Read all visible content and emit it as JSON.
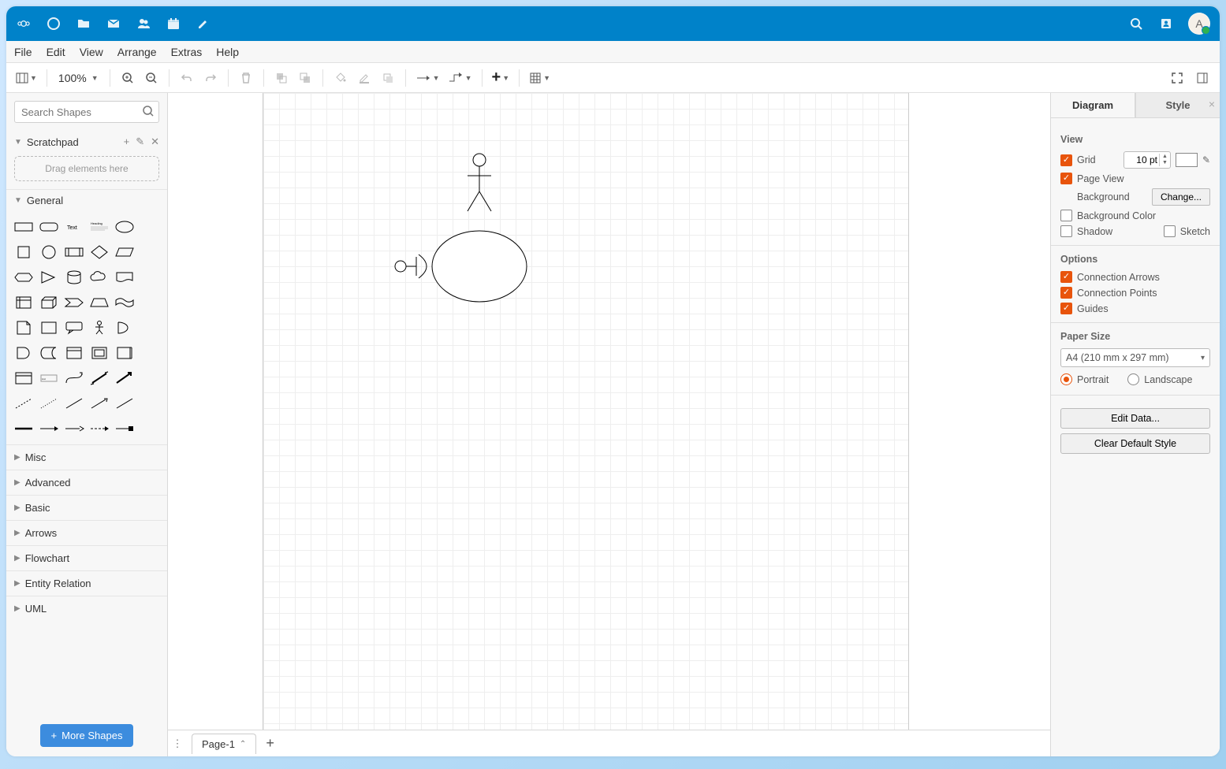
{
  "titlebar": {
    "avatar_initial": "A"
  },
  "menubar": {
    "file": "File",
    "edit": "Edit",
    "view": "View",
    "arrange": "Arrange",
    "extras": "Extras",
    "help": "Help"
  },
  "toolbar": {
    "zoom": "100%"
  },
  "left": {
    "search_placeholder": "Search Shapes",
    "scratchpad": "Scratchpad",
    "scratch_drop": "Drag elements here",
    "general": "General",
    "cats": [
      "Misc",
      "Advanced",
      "Basic",
      "Arrows",
      "Flowchart",
      "Entity Relation",
      "UML"
    ],
    "more": "More Shapes"
  },
  "right": {
    "tab_diagram": "Diagram",
    "tab_style": "Style",
    "view": "View",
    "grid": "Grid",
    "grid_val": "10 pt",
    "pageview": "Page View",
    "background": "Background",
    "change": "Change...",
    "bgcolor": "Background Color",
    "shadow": "Shadow",
    "sketch": "Sketch",
    "options": "Options",
    "conn_arrows": "Connection Arrows",
    "conn_points": "Connection Points",
    "guides": "Guides",
    "paper": "Paper Size",
    "paper_val": "A4 (210 mm x 297 mm)",
    "portrait": "Portrait",
    "landscape": "Landscape",
    "edit_data": "Edit Data...",
    "clear_style": "Clear Default Style"
  },
  "pagebar": {
    "page": "Page-1"
  }
}
